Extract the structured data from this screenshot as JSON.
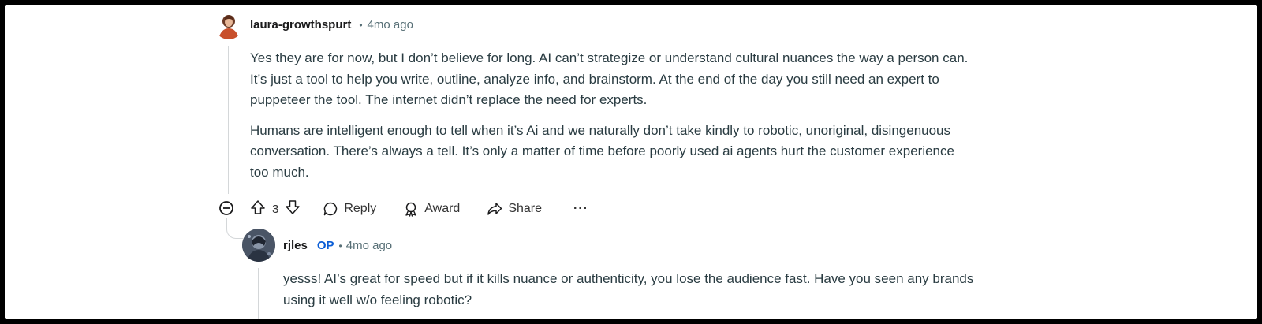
{
  "comment": {
    "author": "laura-growthspurt",
    "separator": "•",
    "time": "4mo ago",
    "paragraphs": [
      "Yes they are for now, but I don’t believe for long. AI can’t strategize or understand cultural nuances the way a person can. It’s just a tool to help you write, outline, analyze info, and brainstorm. At the end of the day you still need an expert to puppeteer the tool. The internet didn’t replace the need for experts.",
      "Humans are intelligent enough to tell when it’s Ai and we naturally don’t take kindly to robotic, unoriginal, disingenuous conversation. There’s always a tell. It’s only a matter of time before poorly used ai agents hurt the customer experience too much."
    ],
    "actions": {
      "vote_count": "3",
      "reply": "Reply",
      "award": "Award",
      "share": "Share",
      "more": "···"
    }
  },
  "reply": {
    "author": "rjles",
    "op_badge": "OP",
    "separator": "•",
    "time": "4mo ago",
    "text": "yesss! AI’s great for speed but if it kills nuance or authenticity, you lose the audience fast. Have you seen any brands using it well w/o feeling robotic?"
  },
  "icons": {
    "upvote": "arrow-up-icon",
    "downvote": "arrow-down-icon",
    "reply": "speech-bubble-icon",
    "award": "award-icon",
    "share": "share-arrow-icon",
    "collapse": "minus-circle-icon"
  },
  "colors": {
    "op": "#0a5dd6",
    "meta": "#576f76",
    "body": "#2a3c42"
  }
}
